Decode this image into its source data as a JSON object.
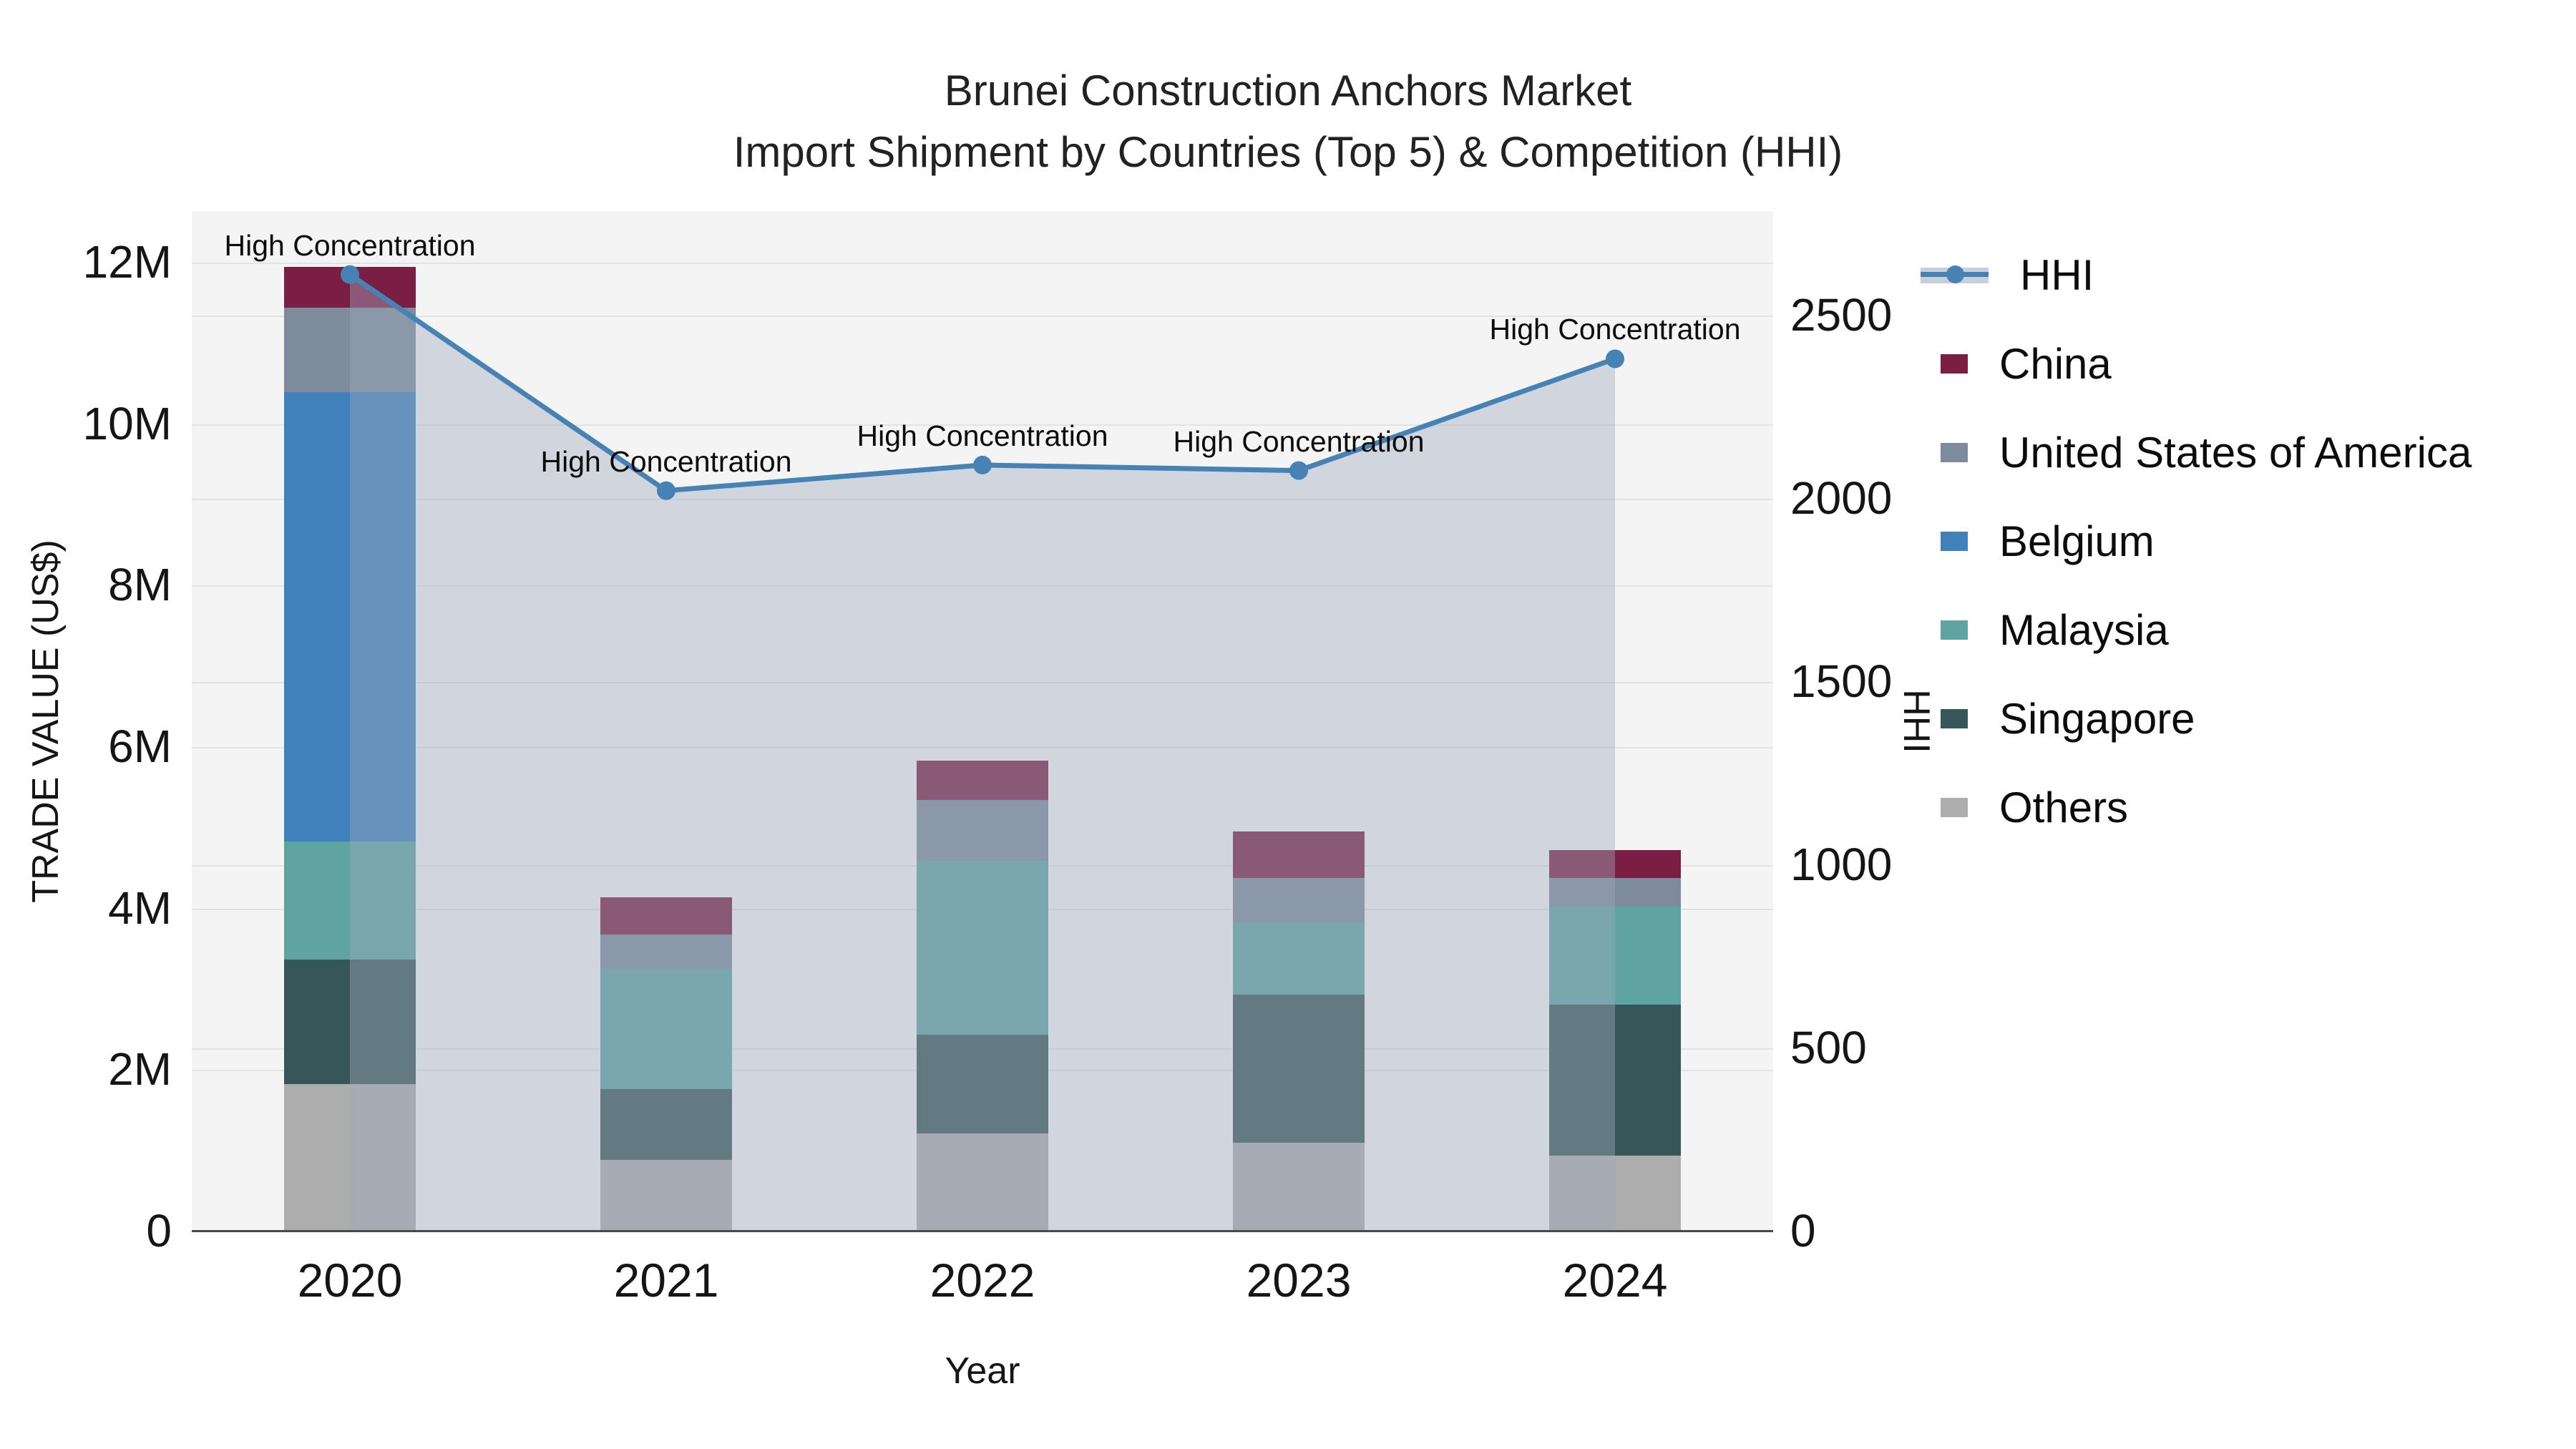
{
  "title": "Brunei Construction Anchors Market",
  "subtitle": "Import Shipment by Countries (Top 5) & Competition (HHI)",
  "axes": {
    "x": {
      "title": "Year",
      "ticks": [
        "2020",
        "2021",
        "2022",
        "2023",
        "2024"
      ]
    },
    "y_left": {
      "title": "TRADE VALUE (US$)",
      "ticks": [
        "0",
        "2M",
        "4M",
        "6M",
        "8M",
        "10M",
        "12M"
      ]
    },
    "y_right": {
      "title": "HHI",
      "ticks": [
        "0",
        "500",
        "1000",
        "1500",
        "2000",
        "2500"
      ]
    }
  },
  "legend": {
    "items": [
      {
        "label": "HHI",
        "color": "#4682B4",
        "type": "line"
      },
      {
        "label": "China",
        "color": "#7B1E44",
        "type": "swatch"
      },
      {
        "label": "United States of America",
        "color": "#7D8B9C",
        "type": "swatch"
      },
      {
        "label": "Belgium",
        "color": "#4080BB",
        "type": "swatch"
      },
      {
        "label": "Malaysia",
        "color": "#60A4A1",
        "type": "swatch"
      },
      {
        "label": "Singapore",
        "color": "#375659",
        "type": "swatch"
      },
      {
        "label": "Others",
        "color": "#ADADAD",
        "type": "swatch"
      }
    ]
  },
  "chart_data": {
    "type": "bar",
    "stacked": true,
    "categories": [
      "2020",
      "2021",
      "2022",
      "2023",
      "2024"
    ],
    "unit": "US$ millions",
    "title": "Brunei Construction Anchors Market — Import Shipment by Countries (Top 5) & Competition (HHI)",
    "xlabel": "Year",
    "ylabel_left": "TRADE VALUE (US$)",
    "ylabel_right": "HHI",
    "y_left_range_millions": [
      0,
      12.64
    ],
    "y_right_range": [
      0,
      2786
    ],
    "grid": true,
    "legend_position": "top-right",
    "stack_order_bottom_to_top": [
      "Others",
      "Singapore",
      "Malaysia",
      "Belgium",
      "United States of America",
      "China"
    ],
    "series": [
      {
        "name": "China",
        "color": "#7B1E44",
        "values_millions": [
          0.51,
          0.46,
          0.49,
          0.57,
          0.34
        ]
      },
      {
        "name": "United States of America",
        "color": "#7D8B9C",
        "values_millions": [
          1.04,
          0.43,
          0.75,
          0.56,
          0.36
        ]
      },
      {
        "name": "Belgium",
        "color": "#4080BB",
        "values_millions": [
          5.57,
          0,
          0,
          0,
          0
        ]
      },
      {
        "name": "Malaysia",
        "color": "#60A4A1",
        "values_millions": [
          1.46,
          1.49,
          2.15,
          0.89,
          1.21
        ]
      },
      {
        "name": "Singapore",
        "color": "#375659",
        "values_millions": [
          1.54,
          0.87,
          1.23,
          1.83,
          1.87
        ]
      },
      {
        "name": "Others",
        "color": "#ADADAD",
        "values_millions": [
          1.83,
          0.89,
          1.21,
          1.1,
          0.94
        ]
      }
    ],
    "line_series": {
      "name": "HHI",
      "axis": "right",
      "color": "#4682B4",
      "area_fill": "rgba(160,172,190,0.42)",
      "values": [
        2610,
        2020,
        2090,
        2075,
        2380
      ],
      "annotation": "High Concentration"
    }
  }
}
